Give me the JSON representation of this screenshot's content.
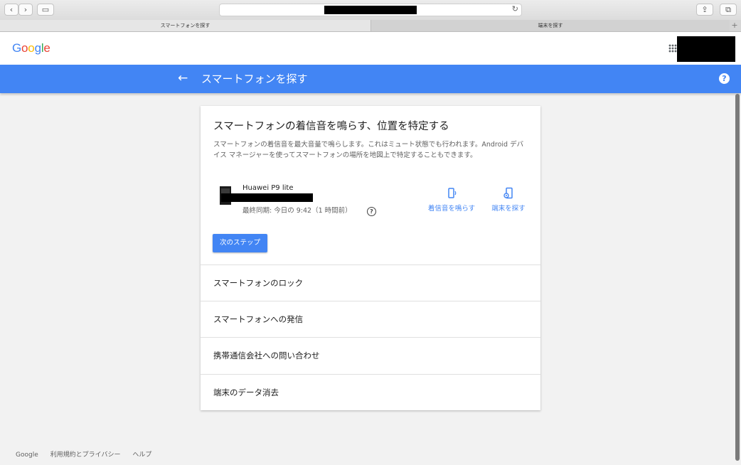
{
  "browser": {
    "tabs": [
      {
        "label": "スマートフォンを探す",
        "active": true
      },
      {
        "label": "端末を探す",
        "active": false
      }
    ],
    "new_tab_label": "+"
  },
  "header": {
    "logo": "Google",
    "apps_icon": "apps-grid-icon"
  },
  "bar": {
    "title": "スマートフォンを探す",
    "back_icon": "arrow-left-icon",
    "help_icon": "help-icon",
    "help_glyph": "?"
  },
  "card": {
    "title": "スマートフォンの着信音を鳴らす、位置を特定する",
    "description": "スマートフォンの着信音を最大音量で鳴らします。これはミュート状態でも行われます。Android デバイス マネージャーを使ってスマートフォンの場所を地図上で特定することもできます。",
    "device": {
      "name": "Huawei P9 lite",
      "last_sync": "最終同期: 今日の 9:42（1 時間前）"
    },
    "actions": [
      {
        "label": "着信音を鳴らす",
        "icon": "phone-ring-icon"
      },
      {
        "label": "端末を探す",
        "icon": "phone-locate-icon"
      }
    ],
    "next_button": "次のステップ",
    "menu": [
      "スマートフォンのロック",
      "スマートフォンへの発信",
      "携帯通信会社への問い合わせ",
      "端末のデータ消去"
    ]
  },
  "footer": {
    "links": [
      "Google",
      "利用規約とプライバシー",
      "ヘルプ"
    ]
  },
  "colors": {
    "accent": "#4285f4",
    "background": "#f2f2f2"
  }
}
